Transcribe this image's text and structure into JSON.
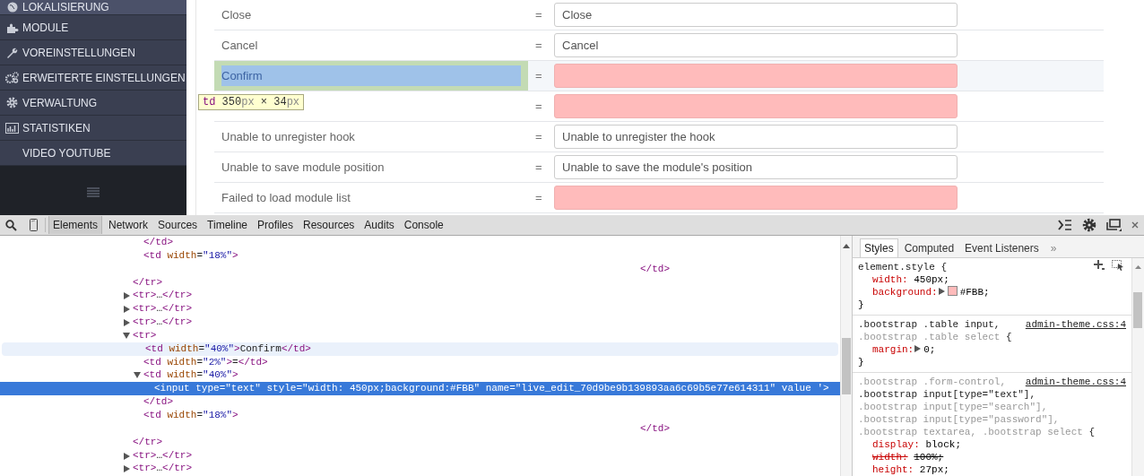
{
  "sidebar": {
    "items": [
      {
        "label": "LOKALISIERUNG",
        "selected": true
      },
      {
        "label": "MODULE",
        "selected": false
      },
      {
        "label": "VOREINSTELLUNGEN",
        "selected": false
      },
      {
        "label": "ERWEITERTE EINSTELLUNGEN",
        "selected": false
      },
      {
        "label": "VERWALTUNG",
        "selected": false
      },
      {
        "label": "STATISTIKEN",
        "selected": false
      },
      {
        "label": "VIDEO YOUTUBE",
        "selected": false
      }
    ]
  },
  "translations": {
    "rows": [
      {
        "label": "Close",
        "sign": "=",
        "value": "Close",
        "missing": false,
        "inspected": false
      },
      {
        "label": "Cancel",
        "sign": "=",
        "value": "Cancel",
        "missing": false,
        "inspected": false
      },
      {
        "label": "Confirm",
        "sign": "=",
        "missing": true,
        "inspected": true
      },
      {
        "sign": "=",
        "missing": true,
        "inspected": false
      },
      {
        "label": "Unable to unregister hook",
        "sign": "=",
        "value": "Unable to unregister the hook",
        "missing": false,
        "inspected": false
      },
      {
        "label": "Unable to save module position",
        "sign": "=",
        "value": "Unable to save the module's position",
        "missing": false,
        "inspected": false
      },
      {
        "label": "Failed to load module list",
        "sign": "=",
        "missing": true,
        "inspected": false
      }
    ],
    "inspector_tooltip": {
      "tag": "td",
      "width_value": "350",
      "width_unit": "px",
      "separator": "×",
      "height_value": "34",
      "height_unit": "px"
    }
  },
  "devtools": {
    "tabs": [
      {
        "label": "Elements",
        "selected": true
      },
      {
        "label": "Network",
        "selected": false
      },
      {
        "label": "Sources",
        "selected": false
      },
      {
        "label": "Timeline",
        "selected": false
      },
      {
        "label": "Profiles",
        "selected": false
      },
      {
        "label": "Resources",
        "selected": false
      },
      {
        "label": "Audits",
        "selected": false
      },
      {
        "label": "Console",
        "selected": false
      }
    ],
    "dom_tree": [
      {
        "children": [
          {
            "text": "</td>"
          },
          {
            "text": "<td width=\"18%\">",
            "trailing_end": "</td>"
          }
        ],
        "end": "</tr>"
      },
      {
        "text": "<tr>…</tr>",
        "expanded": false
      },
      {
        "text": "<tr>…</tr>",
        "expanded": false
      },
      {
        "text": "<tr>…</tr>",
        "expanded": false
      },
      {
        "text": "<tr>",
        "expanded": true,
        "children": [
          {
            "text": "<td width=\"40%\">Confirm</td>",
            "hovered": true
          },
          {
            "text": "<td width=\"2%\">=</td>"
          },
          {
            "text": "<td width=\"40%\">",
            "expanded": true,
            "children": [
              {
                "text": "<input type=\"text\" style=\"width: 450px;background:#FBB\" name=\"live_edit_70d9be9b139893aa6c69b5e77e614311\" value '>",
                "selected": true
              }
            ],
            "end": "</td>"
          },
          {
            "text": "<td width=\"18%\">",
            "trailing_end": "</td>"
          }
        ],
        "end": "</tr>"
      },
      {
        "text": "<tr>…</tr>",
        "expanded": false
      },
      {
        "text": "<tr>…</tr>",
        "expanded": false
      }
    ],
    "styles_pane": {
      "tabs": [
        {
          "label": "Styles",
          "selected": true
        },
        {
          "label": "Computed",
          "selected": false
        },
        {
          "label": "Event Listeners",
          "selected": false
        }
      ],
      "more": "»",
      "rules": [
        {
          "selectors": [
            {
              "text": "element.style",
              "matched": true
            }
          ],
          "open": "{",
          "close": "}",
          "tools": true,
          "properties": [
            {
              "name": "width:",
              "value": "450px;",
              "overridden": false
            },
            {
              "name": "background:",
              "value": "#FBB;",
              "overridden": false,
              "expandable": true,
              "color": "#ffbbbb"
            }
          ]
        },
        {
          "source": "admin-theme.css:4",
          "selectors": [
            {
              "text": ".bootstrap .table input,",
              "matched": true
            },
            {
              "text": ".bootstrap .table select",
              "matched": false
            }
          ],
          "open": "{",
          "close": "}",
          "properties": [
            {
              "name": "margin:",
              "value": "0;",
              "overridden": false,
              "expandable": true
            }
          ]
        },
        {
          "source": "admin-theme.css:4",
          "selectors": [
            {
              "text": ".bootstrap .form-control,",
              "matched": false
            },
            {
              "text": ".bootstrap input[type=\"text\"],",
              "matched": true
            },
            {
              "text": ".bootstrap input[type=\"search\"],",
              "matched": false
            },
            {
              "text": ".bootstrap input[type=\"password\"],",
              "matched": false
            },
            {
              "text": ".bootstrap textarea,",
              "matched": false
            },
            {
              "text": ".bootstrap select",
              "matched": false
            }
          ],
          "open": "{",
          "properties": [
            {
              "name": "display:",
              "value": "block;",
              "overridden": false
            },
            {
              "name": "width:",
              "value": "100%;",
              "overridden": true
            },
            {
              "name": "height:",
              "value": "27px;",
              "overridden": false
            }
          ]
        }
      ]
    }
  }
}
